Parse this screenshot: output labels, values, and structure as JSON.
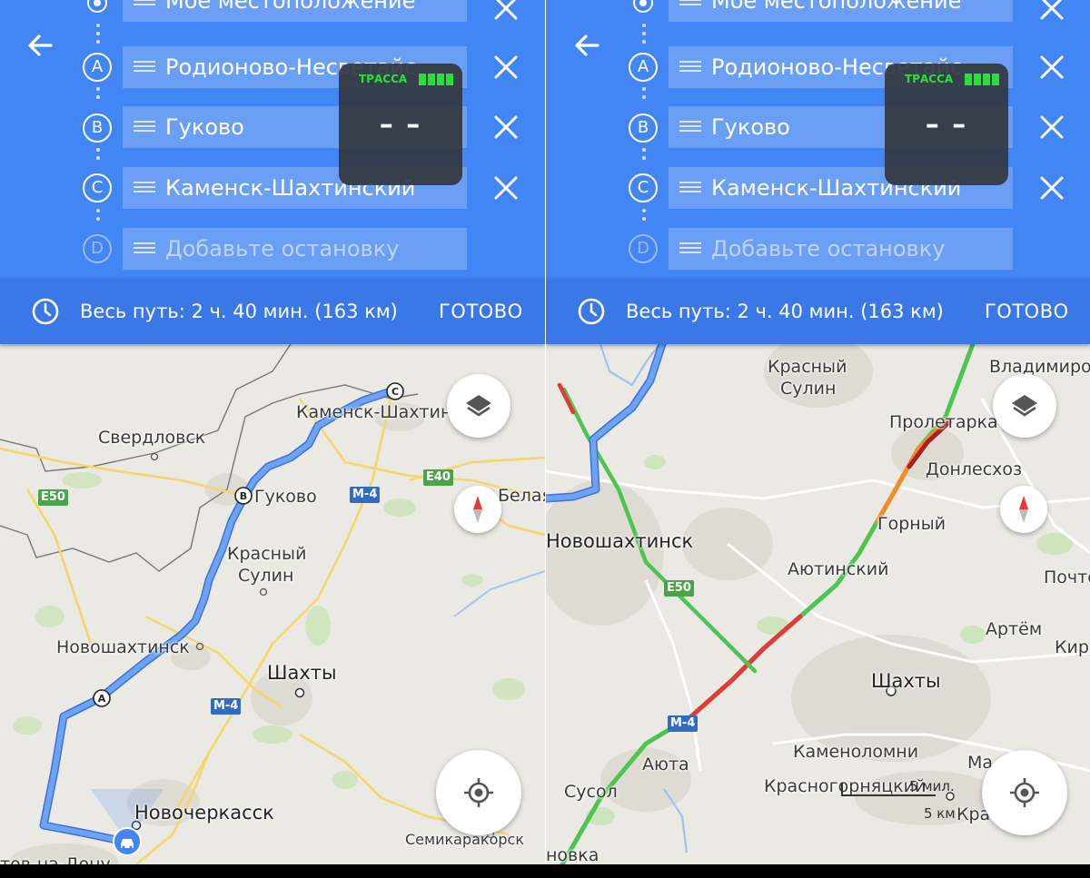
{
  "panels": [
    {
      "header": {
        "back_label": "Back",
        "stops": [
          {
            "letter": "",
            "value": "Мое местоположение",
            "placeholder": false
          },
          {
            "letter": "A",
            "value": "Родионово-Несветайс",
            "placeholder": false
          },
          {
            "letter": "B",
            "value": "Гуково",
            "placeholder": false
          },
          {
            "letter": "C",
            "value": "Каменск-Шахтинский",
            "placeholder": false
          },
          {
            "letter": "D",
            "value": "Добавьте остановку",
            "placeholder": true
          }
        ]
      },
      "speed_widget": {
        "title": "ТРАССА",
        "value": "– –"
      },
      "summary": {
        "total": "Весь путь: 2 ч. 40 мин.  (163 км)",
        "done": "ГОТОВО"
      },
      "map": {
        "labels": [
          "Свердловск",
          "Гуково",
          "Каменск-Шахтин",
          "Красный",
          "Сулин",
          "Новошахтинск",
          "Шахты",
          "Новочеркасск",
          "Семикаракорск",
          "Белая",
          "тов-на-Дону"
        ],
        "shields": [
          "E50",
          "M-4",
          "E40",
          "M-4"
        ],
        "route_markers": [
          "A",
          "B",
          "C"
        ]
      }
    },
    {
      "header": {
        "back_label": "Back",
        "stops": [
          {
            "letter": "",
            "value": "Мое местоположение",
            "placeholder": false
          },
          {
            "letter": "A",
            "value": "Родионово-Несветайс",
            "placeholder": false
          },
          {
            "letter": "B",
            "value": "Гуково",
            "placeholder": false
          },
          {
            "letter": "C",
            "value": "Каменск-Шахтинский",
            "placeholder": false
          },
          {
            "letter": "D",
            "value": "Добавьте остановку",
            "placeholder": true
          }
        ]
      },
      "speed_widget": {
        "title": "ТРАССА",
        "value": "– –"
      },
      "summary": {
        "total": "Весь путь: 2 ч. 40 мин.  (163 км)",
        "done": "ГОТОВО"
      },
      "map": {
        "labels": [
          "Красный",
          "Сулин",
          "Владимиров",
          "Пролетарка",
          "Донлесхоз",
          "Горный",
          "Новошахтинск",
          "Аютинский",
          "Почто",
          "Артём",
          "Киро",
          "Шахты",
          "Аюта",
          "Каменоломни",
          "Ма",
          "Сусол",
          "Красногорняцкий",
          "Красн",
          "новка"
        ],
        "shields": [
          "E50",
          "M-4"
        ],
        "scale_miles": "5 мил.",
        "scale_km": "5 км"
      }
    }
  ],
  "colors": {
    "header": "#4285f4",
    "summary": "#3b78e7",
    "route": "#5a8ff0",
    "traffic_green": "#4cc651",
    "traffic_red": "#e53935",
    "widget_green": "#29e03a"
  }
}
